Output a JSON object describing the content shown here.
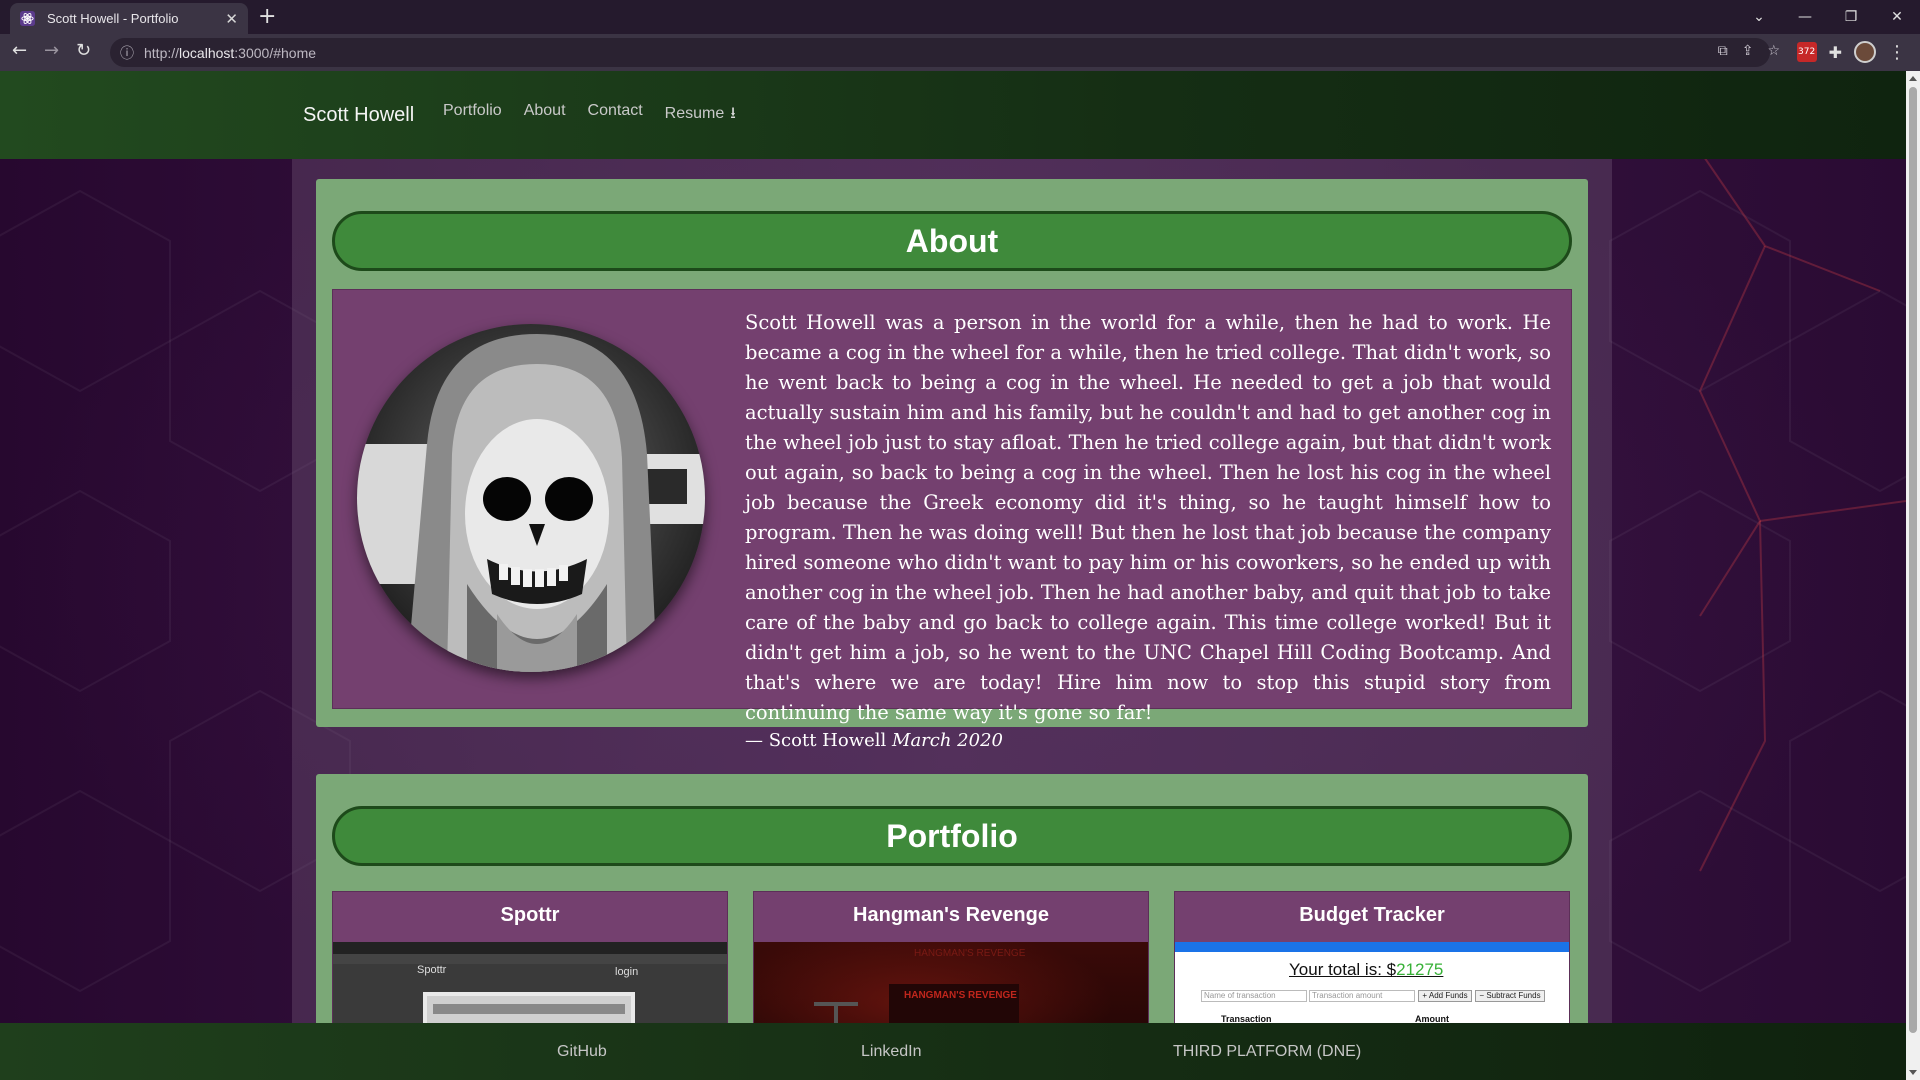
{
  "browser": {
    "tab_title": "Scott Howell - Portfolio",
    "tab_close": "✕",
    "new_tab": "+",
    "url_prefix": "http://",
    "url_host": "localhost",
    "url_rest": ":3000/#home",
    "extension_badge": "372"
  },
  "nav": {
    "brand": "Scott Howell",
    "links": [
      {
        "label": "Portfolio"
      },
      {
        "label": "About"
      },
      {
        "label": "Contact"
      },
      {
        "label": "Resume"
      }
    ]
  },
  "about": {
    "heading": "About",
    "text": "Scott Howell was a person in the world for a while, then he had to work. He became a cog in the wheel for a while, then he tried college. That didn't work, so he went back to being a cog in the wheel. He needed to get a job that would actually sustain him and his family, but he couldn't and had to get another cog in the wheel job just to stay afloat. Then he tried college again, but that didn't work out again, so back to being a cog in the wheel. Then he lost his cog in the wheel job because the Greek economy did it's thing, so he taught himself how to program. Then he was doing well! But then he lost that job because the company hired someone who didn't want to pay him or his coworkers, so he ended up with another cog in the wheel job. Then he had another baby, and quit that job to take care of the baby and go back to college again. This time college worked! But it didn't get him a job, so he went to the UNC Chapel Hill Coding Bootcamp. And that's where we are today! Hire him now to stop this stupid story from continuing the same way it's gone so far!",
    "cite_author": "— Scott Howell",
    "cite_date": "March 2020"
  },
  "portfolio": {
    "heading": "Portfolio",
    "projects": [
      {
        "title": "Spottr",
        "thumb_nav_title": "Spottr",
        "thumb_nav_link": "login"
      },
      {
        "title": "Hangman's Revenge",
        "thumb_title": "HANGMAN'S REVENGE"
      },
      {
        "title": "Budget Tracker",
        "thumb_total_label": "Your total is: $",
        "thumb_total_value": "21275",
        "thumb_name_placeholder": "Name of transaction",
        "thumb_amount_placeholder": "Transaction amount",
        "thumb_add_label": "+ Add Funds",
        "thumb_subtract_label": "− Subtract Funds",
        "thumb_col1": "Transaction",
        "thumb_col2": "Amount"
      }
    ]
  },
  "footer": {
    "links": [
      {
        "label": "GitHub"
      },
      {
        "label": "LinkedIn"
      },
      {
        "label": "THIRD PLATFORM (DNE)"
      }
    ]
  }
}
